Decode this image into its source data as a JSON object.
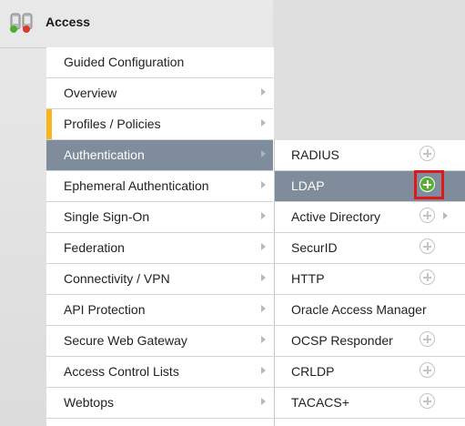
{
  "header": {
    "title": "Access",
    "icon": "access-policy-icon"
  },
  "menu": {
    "items": [
      {
        "label": "Guided Configuration"
      },
      {
        "label": "Overview"
      },
      {
        "label": "Profiles / Policies"
      },
      {
        "label": "Authentication"
      },
      {
        "label": "Ephemeral Authentication"
      },
      {
        "label": "Single Sign-On"
      },
      {
        "label": "Federation"
      },
      {
        "label": "Connectivity / VPN"
      },
      {
        "label": "API Protection"
      },
      {
        "label": "Secure Web Gateway"
      },
      {
        "label": "Access Control Lists"
      },
      {
        "label": "Webtops"
      }
    ]
  },
  "submenu": {
    "items": [
      {
        "label": "RADIUS"
      },
      {
        "label": "LDAP"
      },
      {
        "label": "Active Directory"
      },
      {
        "label": "SecurID"
      },
      {
        "label": "HTTP"
      },
      {
        "label": "Oracle Access Manager"
      },
      {
        "label": "OCSP Responder"
      },
      {
        "label": "CRLDP"
      },
      {
        "label": "TACACS+"
      }
    ]
  },
  "colors": {
    "active_bg": "#7f8c9c",
    "accent": "#f6b51c",
    "add_active": "#58b02f",
    "highlight": "#e01818"
  }
}
